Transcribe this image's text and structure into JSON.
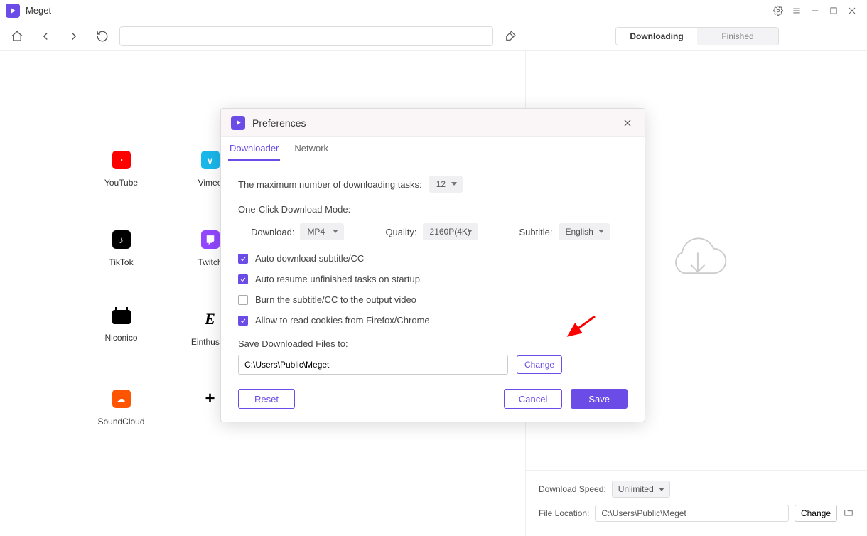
{
  "app": {
    "title": "Meget"
  },
  "tabs": {
    "downloading": "Downloading",
    "finished": "Finished"
  },
  "sites": [
    {
      "key": "youtube",
      "label": "YouTube"
    },
    {
      "key": "vimeo",
      "label": "Vimeo"
    },
    {
      "key": "tiktok",
      "label": "TikTok"
    },
    {
      "key": "twitch",
      "label": "Twitch"
    },
    {
      "key": "niconico",
      "label": "Niconico"
    },
    {
      "key": "einthusan",
      "label": "Einthusan"
    },
    {
      "key": "soundcloud",
      "label": "SoundCloud"
    },
    {
      "key": "add",
      "label": ""
    }
  ],
  "rightPane": {
    "speedLabel": "Download Speed:",
    "speedValue": "Unlimited",
    "locationLabel": "File Location:",
    "locationValue": "C:\\Users\\Public\\Meget",
    "changeBtn": "Change"
  },
  "modal": {
    "title": "Preferences",
    "tabs": {
      "downloader": "Downloader",
      "network": "Network"
    },
    "maxTasksLabel": "The maximum number of downloading tasks:",
    "maxTasksValue": "12",
    "oneClickLabel": "One-Click Download Mode:",
    "downloadLabel": "Download:",
    "downloadValue": "MP4",
    "qualityLabel": "Quality:",
    "qualityValue": "2160P(4K)",
    "subtitleLabel": "Subtitle:",
    "subtitleValue": "English",
    "chk1": "Auto download subtitle/CC",
    "chk2": "Auto resume unfinished tasks on startup",
    "chk3": "Burn the subtitle/CC to the output video",
    "chk4": "Allow to read cookies from Firefox/Chrome",
    "saveToLabel": "Save Downloaded Files to:",
    "saveToValue": "C:\\Users\\Public\\Meget",
    "changeBtn": "Change",
    "resetBtn": "Reset",
    "cancelBtn": "Cancel",
    "saveBtn": "Save"
  }
}
